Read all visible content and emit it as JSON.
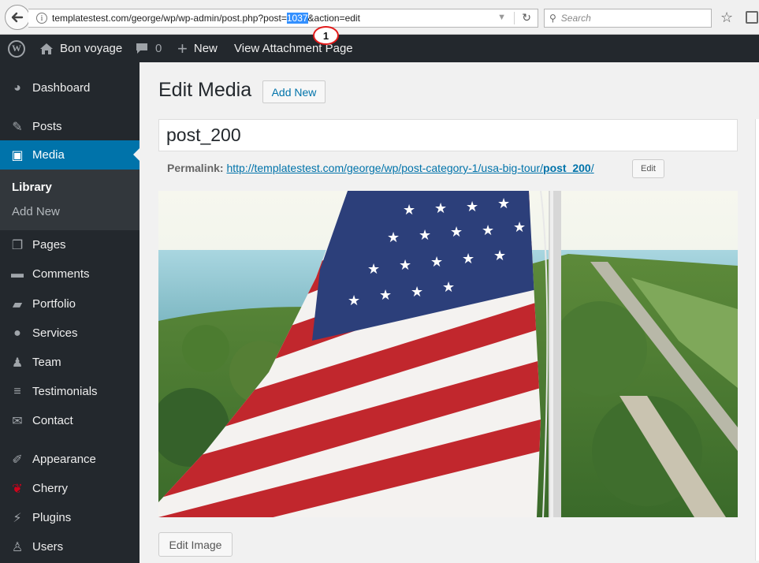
{
  "browser": {
    "url_prefix": "templatestest.com/george/wp/wp-admin/post.php?post=",
    "url_highlight": "1037",
    "url_suffix": "&action=edit",
    "search_placeholder": "Search",
    "callout_number": "1"
  },
  "adminbar": {
    "site_name": "Bon voyage",
    "comments_count": "0",
    "new_label": "New",
    "view_label": "View Attachment Page"
  },
  "sidebar": {
    "items": [
      {
        "label": "Dashboard",
        "icon": "dashboard-icon"
      },
      {
        "label": "Posts",
        "icon": "pin-icon"
      },
      {
        "label": "Media",
        "icon": "media-icon"
      },
      {
        "label": "Pages",
        "icon": "pages-icon"
      },
      {
        "label": "Comments",
        "icon": "comment-icon"
      },
      {
        "label": "Portfolio",
        "icon": "folder-icon"
      },
      {
        "label": "Services",
        "icon": "lightbulb-icon"
      },
      {
        "label": "Team",
        "icon": "person-icon"
      },
      {
        "label": "Testimonials",
        "icon": "quote-icon"
      },
      {
        "label": "Contact",
        "icon": "mail-icon"
      },
      {
        "label": "Appearance",
        "icon": "brush-icon"
      },
      {
        "label": "Cherry",
        "icon": "cherry-icon"
      },
      {
        "label": "Plugins",
        "icon": "plug-icon"
      },
      {
        "label": "Users",
        "icon": "user-icon"
      }
    ],
    "submenu": [
      "Library",
      "Add New"
    ]
  },
  "main": {
    "page_title": "Edit Media",
    "add_new_label": "Add New",
    "title_value": "post_200",
    "permalink_label": "Permalink:",
    "permalink_url_base": "http://templatestest.com/george/wp/post-category-1/usa-big-tour/",
    "permalink_slug": "post_200",
    "permalink_url_end": "/",
    "permalink_edit": "Edit",
    "edit_image_label": "Edit Image"
  },
  "colors": {
    "admin_dark": "#23282d",
    "active_blue": "#0073aa",
    "callout_red": "#e21a1a"
  }
}
